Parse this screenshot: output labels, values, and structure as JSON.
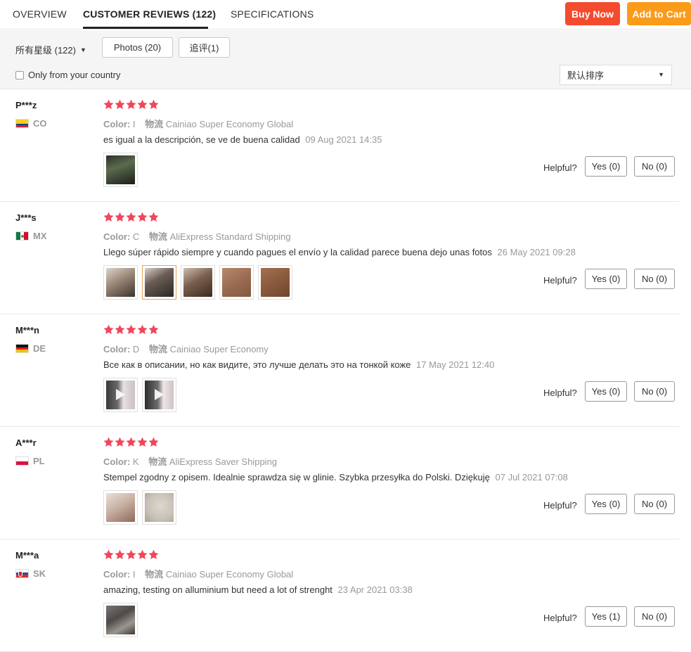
{
  "tabs": [
    {
      "label": "OVERVIEW"
    },
    {
      "label": "CUSTOMER REVIEWS (122)"
    },
    {
      "label": "SPECIFICATIONS"
    }
  ],
  "actions": {
    "buy_now": "Buy Now",
    "add_to_cart": "Add to Cart"
  },
  "colors": {
    "buy_now": "#f44b2e",
    "add_to_cart": "#fa9b1a",
    "stars": "#f0475c"
  },
  "filters": {
    "stars_label": "所有星级 (122)",
    "photos": "Photos (20)",
    "followup": "追评(1)",
    "country_label": "Only from your country",
    "sort_label": "默认排序"
  },
  "helpful_label": "Helpful?",
  "reviews": [
    {
      "user": "P***z",
      "country": "CO",
      "rating": 5,
      "color_label": "Color:",
      "color_value": "I",
      "shipping_label": "物流",
      "shipping_value": "Cainiao Super Economy Global",
      "text": "es igual a la descripción, se ve de buena calidad",
      "date": "09 Aug 2021 14:35",
      "yes": "Yes (0)",
      "no": "No (0)",
      "photos": [
        "phone-photo"
      ]
    },
    {
      "user": "J***s",
      "country": "MX",
      "rating": 5,
      "color_label": "Color:",
      "color_value": "C",
      "shipping_label": "物流",
      "shipping_value": "AliExpress Standard Shipping",
      "text": "Llego súper rápido siempre y cuando pagues el envío y la calidad parece buena dejo unas fotos",
      "date": "26 May 2021 09:28",
      "yes": "Yes (0)",
      "no": "No (0)",
      "photos": [
        "stamp-hand-1",
        "stamp-hand-2",
        "stamp-hand-3",
        "stamp-imprint-1",
        "stamp-imprint-2"
      ]
    },
    {
      "user": "M***n",
      "country": "DE",
      "rating": 5,
      "color_label": "Color:",
      "color_value": "D",
      "shipping_label": "物流",
      "shipping_value": "Cainiao Super Economy",
      "text": "Все как в описании, но как видите, это лучше делать это на тонкой коже",
      "date": "17 May 2021 12:40",
      "yes": "Yes (0)",
      "no": "No (0)",
      "photos": [
        "video-1",
        "video-2"
      ]
    },
    {
      "user": "A***r",
      "country": "PL",
      "rating": 5,
      "color_label": "Color:",
      "color_value": "K",
      "shipping_label": "物流",
      "shipping_value": "AliExpress Saver Shipping",
      "text": "Stempel zgodny z opisem. Idealnie sprawdza się w glinie. Szybka przesyłka do Polski. Dziękuję",
      "date": "07 Jul 2021 07:08",
      "yes": "Yes (0)",
      "no": "No (0)",
      "photos": [
        "clay-1",
        "clay-2"
      ]
    },
    {
      "user": "M***a",
      "country": "SK",
      "rating": 5,
      "color_label": "Color:",
      "color_value": "I",
      "shipping_label": "物流",
      "shipping_value": "Cainiao Super Economy Global",
      "text": "amazing, testing on alluminium but need a lot of strenght",
      "date": "23 Apr 2021 03:38",
      "yes": "Yes (1)",
      "no": "No (0)",
      "photos": [
        "aluminium-1"
      ]
    }
  ]
}
